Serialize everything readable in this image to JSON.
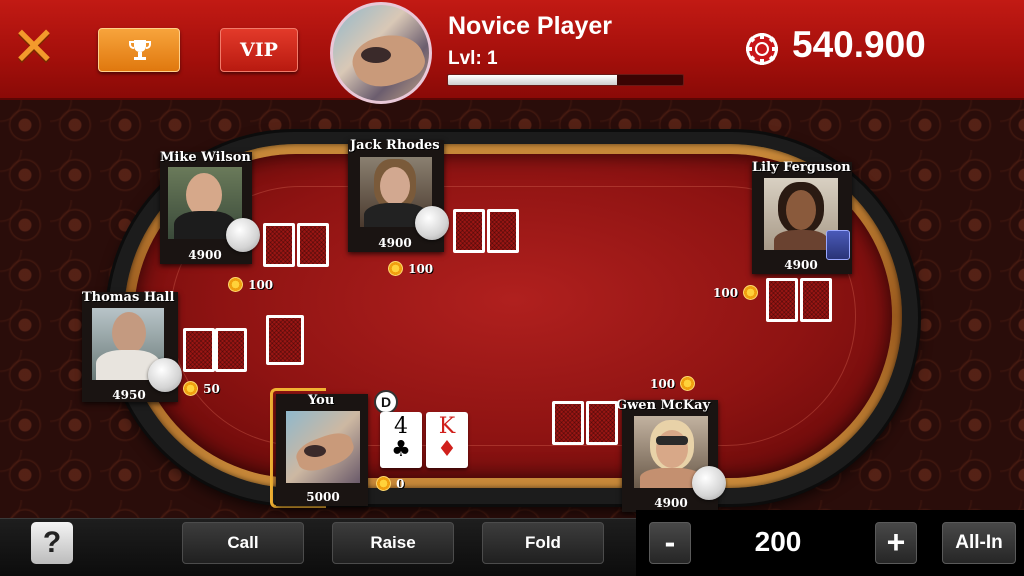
{
  "header": {
    "close_icon": "close-icon",
    "trophy_icon": "trophy-icon",
    "vip_label": "VIP",
    "player_name": "Novice Player",
    "player_level": "Lvl: 1",
    "xp_progress": 0.72,
    "chips_icon": "poker-chip-icon",
    "chips_balance": "540.900"
  },
  "seats": [
    {
      "name": "Mike Wilson",
      "stack": "4900",
      "bet": "100"
    },
    {
      "name": "Jack Rhodes",
      "stack": "4900",
      "bet": "100"
    },
    {
      "name": "Lily Ferguson",
      "stack": "4900",
      "bet": "100"
    },
    {
      "name": "Thomas Hall",
      "stack": "4950",
      "bet": "50"
    },
    {
      "name": "You",
      "stack": "5000",
      "bet": "0"
    },
    {
      "name": "Gwen McKay",
      "stack": "4900",
      "bet": "100"
    }
  ],
  "dealer_label": "D",
  "hole_cards": [
    {
      "rank": "4",
      "suit": "♣",
      "color": "#111111"
    },
    {
      "rank": "K",
      "suit": "♦",
      "color": "#d0201c"
    }
  ],
  "actions": {
    "help_label": "?",
    "call_label": "Call",
    "raise_label": "Raise",
    "fold_label": "Fold",
    "minus_label": "-",
    "bet_amount": "200",
    "plus_label": "+",
    "allin_label": "All-In"
  },
  "colors": {
    "header_red": "#b3140f",
    "accent_orange": "#f39a2c",
    "felt_red": "#9a1715",
    "highlight_gold": "#f2b233"
  }
}
